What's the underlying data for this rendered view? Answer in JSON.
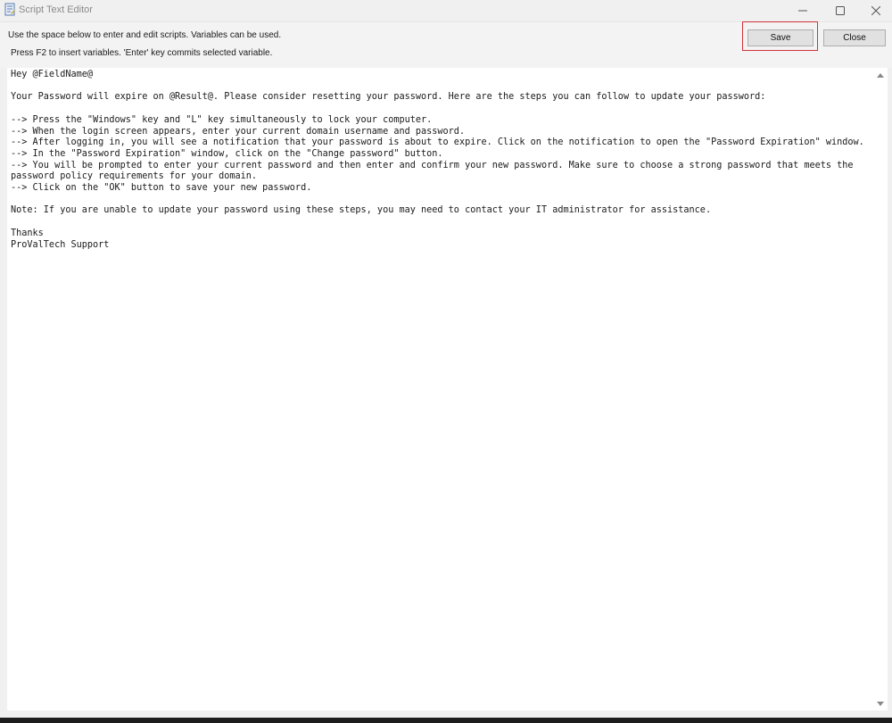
{
  "window": {
    "title": "Script Text Editor",
    "icon": "script-editor-icon"
  },
  "window_controls": {
    "minimize": "minimize-icon",
    "maximize": "maximize-icon",
    "close": "close-icon"
  },
  "header": {
    "instruction_line1": "Use the space below to enter and edit scripts. Variables can be used.",
    "instruction_line2": "Press F2 to insert variables. 'Enter' key commits selected variable.",
    "save_label": "Save",
    "close_label": "Close",
    "highlight_color": "#d0333a"
  },
  "editor": {
    "lines": [
      "Hey @FieldName@",
      "",
      "Your Password will expire on @Result@. Please consider resetting your password. Here are the steps you can follow to update your password:",
      "",
      "--> Press the \"Windows\" key and \"L\" key simultaneously to lock your computer.",
      "--> When the login screen appears, enter your current domain username and password.",
      "--> After logging in, you will see a notification that your password is about to expire. Click on the notification to open the \"Password Expiration\" window.",
      "--> In the \"Password Expiration\" window, click on the \"Change password\" button.",
      "--> You will be prompted to enter your current password and then enter and confirm your new password. Make sure to choose a strong password that meets the",
      "password policy requirements for your domain.",
      "--> Click on the \"OK\" button to save your new password.",
      "",
      "Note: If you are unable to update your password using these steps, you may need to contact your IT administrator for assistance.",
      "",
      "Thanks",
      "ProValTech Support"
    ]
  },
  "scrollbar": {
    "up": "scroll-up-arrow-icon",
    "down": "scroll-down-arrow-icon"
  }
}
